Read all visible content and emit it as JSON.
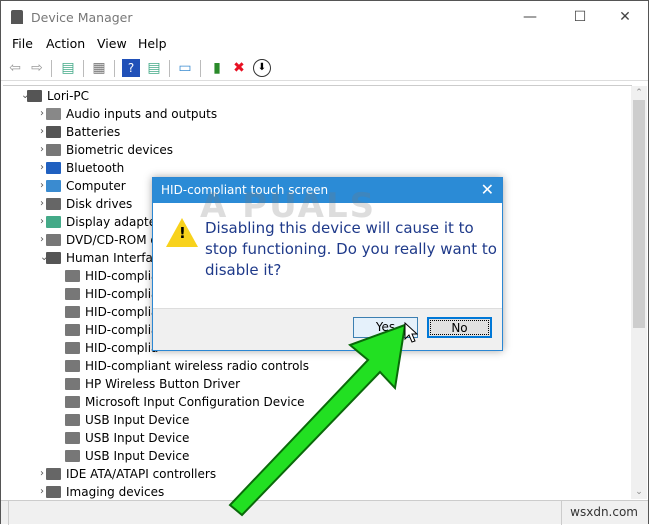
{
  "window": {
    "title": "Device Manager",
    "minimize": "—",
    "maximize": "☐",
    "close": "✕"
  },
  "menu": [
    "File",
    "Action",
    "View",
    "Help"
  ],
  "toolbar": {
    "icons": [
      "back-arrow-icon",
      "forward-arrow-icon",
      "properties-icon",
      "update-icon",
      "help-icon",
      "console-icon",
      "scan-hardware-icon",
      "enable-device-icon",
      "uninstall-x-icon",
      "disable-down-arrow-icon"
    ],
    "uninstall_color": "#e81123"
  },
  "tree": {
    "root": "Lori-PC",
    "categories": [
      "Audio inputs and outputs",
      "Batteries",
      "Biometric devices",
      "Bluetooth",
      "Computer",
      "Disk drives",
      "Display adapters",
      "DVD/CD-ROM d",
      "Human Interface"
    ],
    "hid_children": [
      "HID-complia",
      "HID-complia",
      "HID-complia",
      "HID-complia",
      "HID-complia",
      "HID-compliant wireless radio controls",
      "HP Wireless Button Driver",
      "Microsoft Input Configuration Device",
      "USB Input Device",
      "USB Input Device",
      "USB Input Device"
    ],
    "after": [
      "IDE ATA/ATAPI controllers",
      "Imaging devices"
    ]
  },
  "dialog": {
    "title": "HID-compliant touch screen",
    "close": "✕",
    "message": "Disabling this device will cause it to stop functioning. Do you really want to disable it?",
    "yes": "Yes",
    "no": "No",
    "accent": "#2b8bd6"
  },
  "watermarks": {
    "brand": "A PUALS",
    "site": "wsxdn.com"
  }
}
